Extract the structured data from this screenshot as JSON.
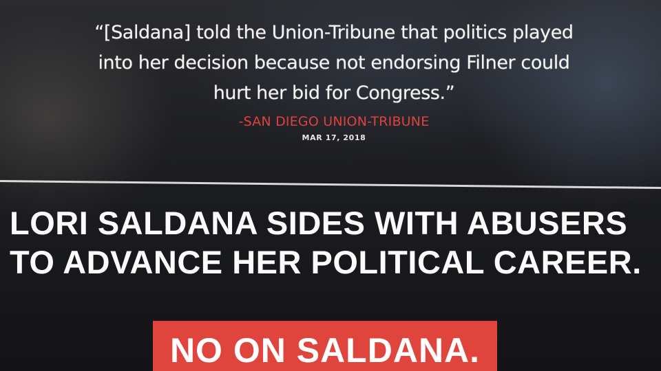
{
  "quote": {
    "text": "“[Saldana] told the Union-Tribune that politics played into her decision because not endorsing Filner could hurt her bid for Congress.”",
    "source": "-SAN DIEGO UNION-TRIBUNE",
    "date": "MAR 17, 2018"
  },
  "headline": {
    "line1": "LORI SALDANA SIDES WITH ABUSERS",
    "line2": "TO ADVANCE HER POLITICAL CAREER."
  },
  "cta": {
    "label": "NO ON SALDANA."
  },
  "colors": {
    "accent_red": "#e0453d",
    "background": "#1c1d21",
    "text": "#f4f4f2"
  }
}
